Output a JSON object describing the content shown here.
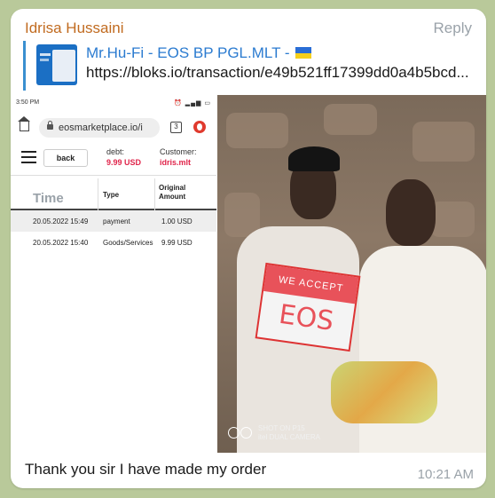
{
  "message": {
    "sender": "Idrisa Hussaini",
    "reply_label": "Reply",
    "quote": {
      "title": "Mr.Hu-Fi - EOS BP PGL.MLT -",
      "url": "https://bloks.io/transaction/e49b521ff17399dd0a4b5bcd..."
    },
    "caption": "Thank you sir I have made my order",
    "time": "10:21 AM"
  },
  "phone": {
    "status_time": "3:50 PM",
    "address": "eosmarketplace.io/i",
    "tabs_count": "3",
    "back_label": "back",
    "debt_label": "debt:",
    "debt_value": "9.99 USD",
    "customer_label": "Customer:",
    "customer_value": "idris.mlt",
    "table": {
      "headers": {
        "time": "Time",
        "type": "Type",
        "amount": "Original Amount"
      },
      "rows": [
        {
          "time": "20.05.2022 15:49",
          "type": "payment",
          "amount": "1.00 USD"
        },
        {
          "time": "20.05.2022 15:40",
          "type": "Goods/Services",
          "amount": "9.99 USD"
        }
      ]
    }
  },
  "photo": {
    "sign_top": "WE ACCEPT",
    "sign_brand": "EOS",
    "watermark_line1": "SHOT ON P15",
    "watermark_line2": "itel DUAL CAMERA"
  },
  "colors": {
    "sender": "#c16b20",
    "link": "#2b7bd0",
    "accent_red": "#e0254b"
  }
}
